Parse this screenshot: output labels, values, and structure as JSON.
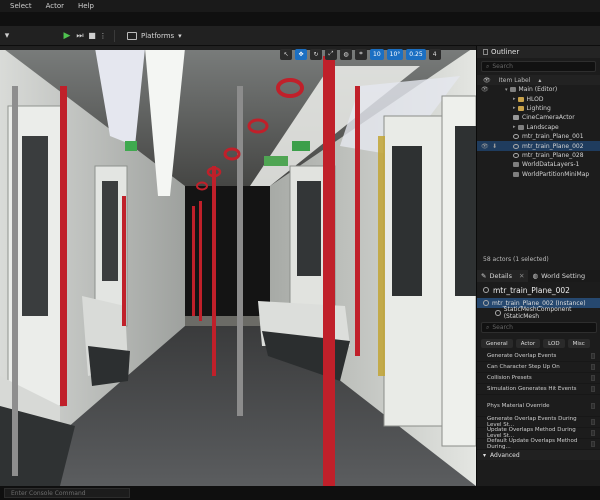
{
  "menu": [
    "Select",
    "Actor",
    "Help"
  ],
  "toolbar": {
    "platforms_label": "Platforms"
  },
  "viewport": {
    "tools": [
      "10",
      "10°",
      "0.25",
      "4"
    ]
  },
  "outliner": {
    "tab_label": "Outliner",
    "search_placeholder": "Search",
    "column_label": "Item Label",
    "rows": [
      {
        "label": "Main (Editor)",
        "icon": "world-icon",
        "indent": 0,
        "caret": "▾"
      },
      {
        "label": "HLOD",
        "icon": "folder-icon",
        "indent": 1,
        "caret": "▸"
      },
      {
        "label": "Lighting",
        "icon": "folder-icon",
        "indent": 1,
        "caret": "▸"
      },
      {
        "label": "CineCameraActor",
        "icon": "camera-icon",
        "indent": 1,
        "caret": ""
      },
      {
        "label": "Landscape",
        "icon": "landscape-icon",
        "indent": 1,
        "caret": "▸"
      },
      {
        "label": "mtr_train_Plane_001",
        "icon": "mesh-icon",
        "indent": 1,
        "caret": ""
      },
      {
        "label": "mtr_train_Plane_002",
        "icon": "mesh-icon",
        "indent": 1,
        "caret": "",
        "selected": true
      },
      {
        "label": "mtr_train_Plane_028",
        "icon": "mesh-icon",
        "indent": 1,
        "caret": ""
      },
      {
        "label": "WorldDataLayers-1",
        "icon": "world-icon",
        "indent": 1,
        "caret": ""
      },
      {
        "label": "WorldPartitionMiniMap",
        "icon": "world-icon",
        "indent": 1,
        "caret": ""
      }
    ],
    "actor_count": "58 actors (1 selected)"
  },
  "details": {
    "tab_label": "Details",
    "world_tab_label": "World Setting",
    "object_name": "mtr_train_Plane_002",
    "instance_label": "mtr_train_Plane_002 (Instance)",
    "component_label": "StaticMeshComponent (StaticMesh",
    "search_placeholder": "Search",
    "filters": [
      "General",
      "Actor",
      "LOD",
      "Misc"
    ],
    "properties": [
      "Generate Overlap Events",
      "Can Character Step Up On",
      "Collision Presets",
      "Simulation Generates Hit Events",
      "Phys Material Override",
      "Generate Overlap Events During Level St...",
      "Update Overlaps Method During Level St...",
      "Default Update Overlaps Method During..."
    ],
    "advanced_label": "Advanced"
  },
  "console": {
    "placeholder": "Enter Console Command"
  },
  "colors": {
    "accent": "#1b6fc2",
    "selection": "#1f3c5e",
    "pole_red": "#c0202a",
    "play_green": "#4fc24f"
  }
}
